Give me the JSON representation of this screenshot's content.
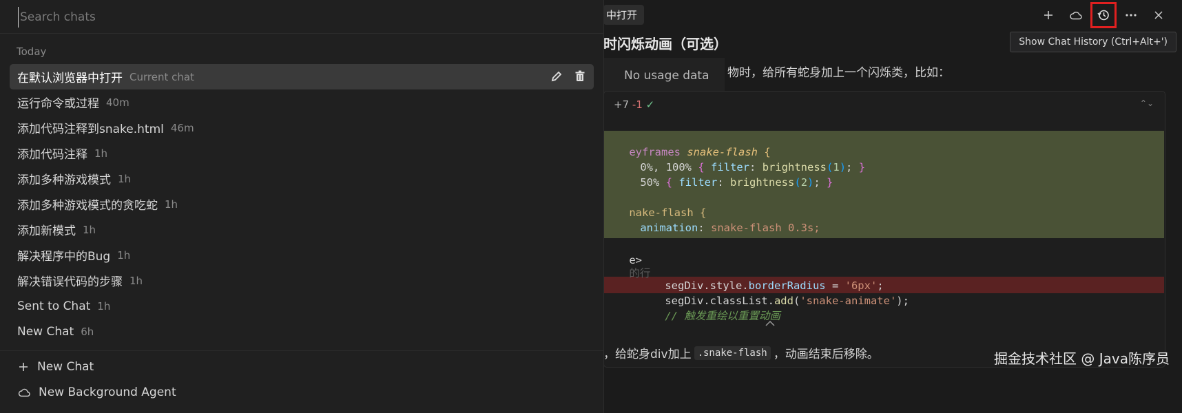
{
  "search": {
    "placeholder": "Search chats"
  },
  "section_today": "Today",
  "chats": [
    {
      "title": "在默认浏览器中打开",
      "time": "Current chat",
      "active": true
    },
    {
      "title": "运行命令或过程",
      "time": "40m"
    },
    {
      "title": "添加代码注释到snake.html",
      "time": "46m"
    },
    {
      "title": "添加代码注释",
      "time": "1h"
    },
    {
      "title": "添加多种游戏模式",
      "time": "1h"
    },
    {
      "title": "添加多种游戏模式的贪吃蛇",
      "time": "1h"
    },
    {
      "title": "添加新模式",
      "time": "1h"
    },
    {
      "title": "解决程序中的Bug",
      "time": "1h"
    },
    {
      "title": "解决错误代码的步骤",
      "time": "1h"
    },
    {
      "title": "Sent to Chat",
      "time": "1h"
    },
    {
      "title": "New Chat",
      "time": "6h"
    }
  ],
  "footer": {
    "new_chat": "New Chat",
    "new_agent": "New Background Agent"
  },
  "right": {
    "tab_label": "中打开",
    "heading": "时闪烁动画（可选）",
    "tooltip": "Show Chat History (Ctrl+Alt+')",
    "usage": "No usage data",
    "para": "物时，给所有蛇身加上一个闪烁类，比如：",
    "diff_summary": {
      "added": "+7",
      "removed": "-1"
    },
    "code": {
      "l1_kw": "eyframes",
      "l1_name": "snake-flash",
      "l2": "0%, 100% { filter: brightness(1); }",
      "l3": "50% { filter: brightness(2); }",
      "l4_sel": "nake-flash {",
      "l5_prop": "animation",
      "l5_val": "snake-flash 0.3s;",
      "l6": "e>",
      "l7": "的行",
      "l8_obj": "segDiv.style.",
      "l8_prop": "borderRadius",
      "l8_val": "'6px'",
      "l9_obj": "segDiv.classList.",
      "l9_fn": "add",
      "l9_val": "'snake-animate'",
      "l10": "// 触发重绘以重置动画"
    },
    "bottom_text_1": "，给蛇身div加上",
    "bottom_code": ".snake-flash",
    "bottom_text_2": "，动画结束后移除。",
    "watermark": "掘金技术社区 @ Java陈序员"
  }
}
